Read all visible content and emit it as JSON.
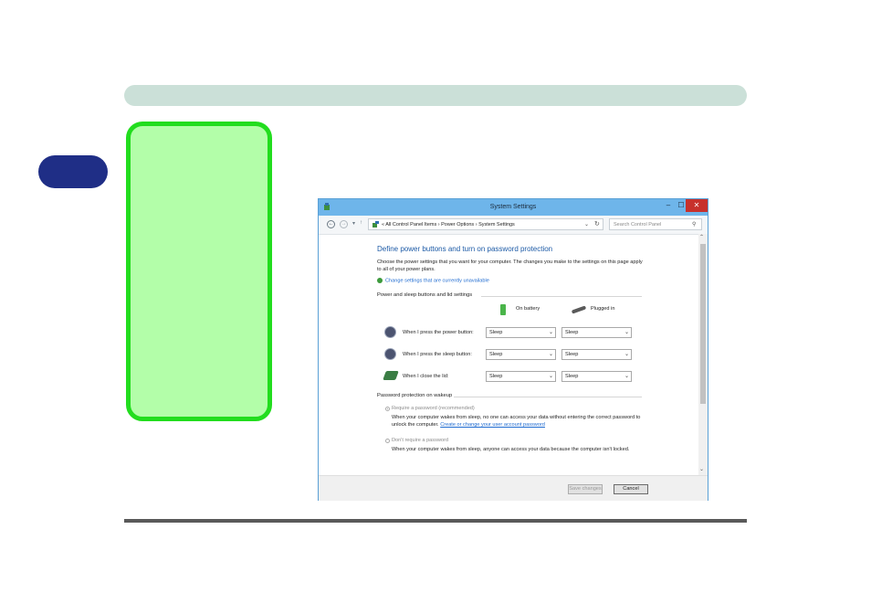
{
  "window": {
    "title": "System Settings",
    "controls": {
      "minimize": "–",
      "maximize": "☐",
      "close": "✕"
    }
  },
  "address": {
    "back": "←",
    "forward": "→",
    "path": "« All Control Panel Items › Power Options › System Settings",
    "search_placeholder": "Search Control Panel"
  },
  "content": {
    "heading": "Define power buttons and turn on password protection",
    "intro": "Choose the power settings that you want for your computer. The changes you make to the settings on this page apply to all of your power plans.",
    "change_link": "Change settings that are currently unavailable",
    "section_buttons": "Power and sleep buttons and lid settings",
    "col_battery": "On battery",
    "col_plugged": "Plugged in",
    "rows": [
      {
        "label": "When I press the power button:",
        "battery": "Sleep",
        "plugged": "Sleep"
      },
      {
        "label": "When I press the sleep button:",
        "battery": "Sleep",
        "plugged": "Sleep"
      },
      {
        "label": "When I close the lid:",
        "battery": "Sleep",
        "plugged": "Sleep"
      }
    ],
    "section_password": "Password protection on wakeup",
    "require_label": "Require a password (recommended)",
    "require_desc": "When your computer wakes from sleep, no one can access your data without entering the correct password to unlock the computer.",
    "require_link": "Create or change your user account password",
    "norequire_label": "Don't require a password",
    "norequire_desc": "When your computer wakes from sleep, anyone can access your data because the computer isn't locked."
  },
  "buttons": {
    "save": "Save changes",
    "cancel": "Cancel"
  }
}
